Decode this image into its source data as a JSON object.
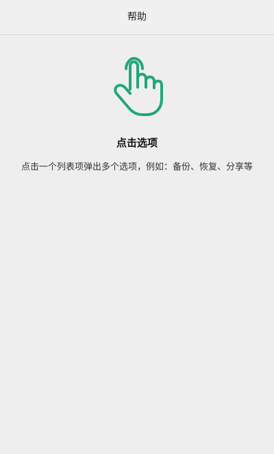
{
  "header": {
    "title": "帮助"
  },
  "help_item": {
    "icon": "tap-hand-icon",
    "title": "点击选项",
    "description": "点击一个列表项弹出多个选项，例如：备份、恢复、分享等"
  },
  "colors": {
    "accent": "#21a67a",
    "background": "#efeeef"
  }
}
